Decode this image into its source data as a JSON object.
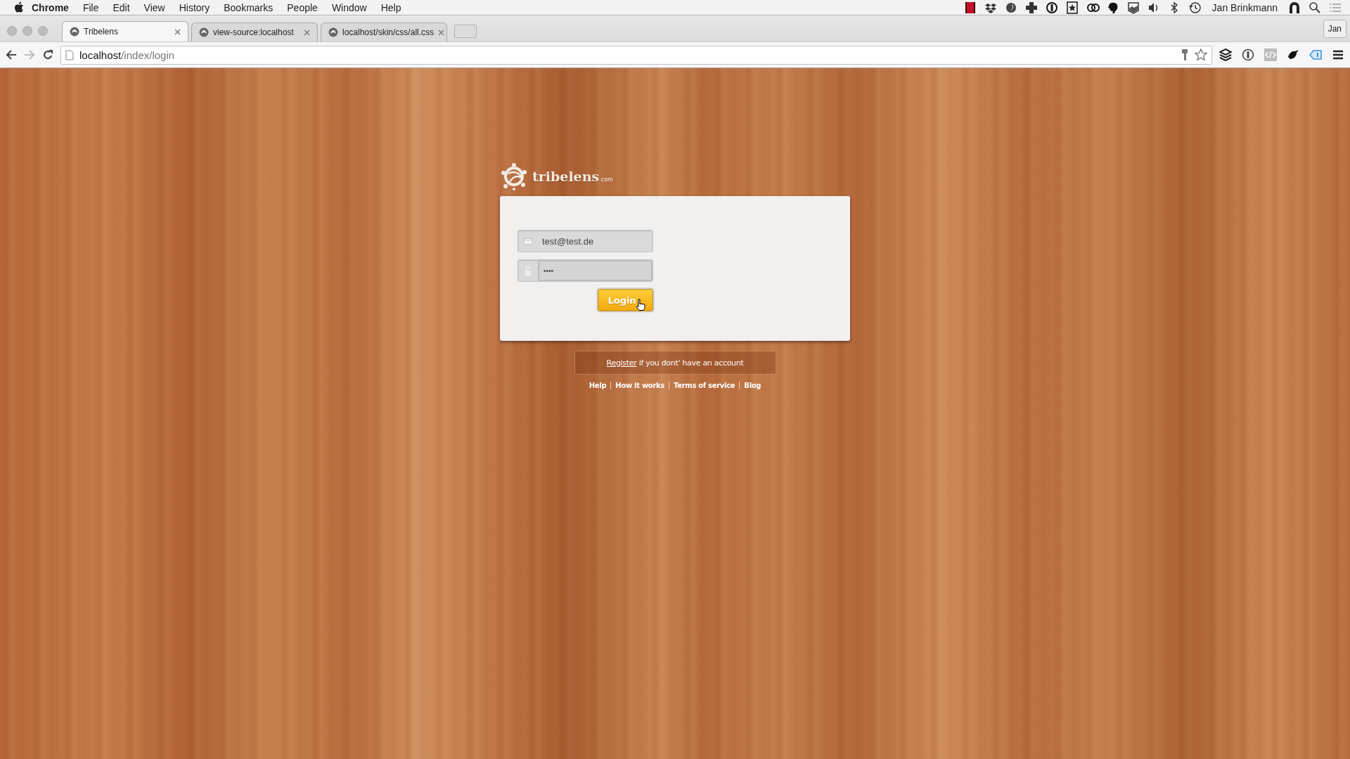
{
  "menu_bar": {
    "app": "Chrome",
    "items": [
      "File",
      "Edit",
      "View",
      "History",
      "Bookmarks",
      "People",
      "Window",
      "Help"
    ],
    "user": "Jan Brinkmann"
  },
  "tabs": [
    {
      "title": "Tribelens",
      "selected": true
    },
    {
      "title": "view-source:localhost",
      "selected": false
    },
    {
      "title": "localhost/skin/css/all.css",
      "selected": false
    }
  ],
  "profile_button": "Jan",
  "toolbar": {
    "forward_disabled": true,
    "url_host": "localhost",
    "url_path": "/index/login"
  },
  "logo": {
    "name": "tribelens",
    "suffix": ".com"
  },
  "login_form": {
    "email": "test@test.de",
    "password": "••••",
    "button": "Login"
  },
  "register": {
    "link": "Register",
    "text": "if you dont' have an account"
  },
  "footer_links": [
    "Help",
    "How it works",
    "Terms of service",
    "Blog"
  ]
}
